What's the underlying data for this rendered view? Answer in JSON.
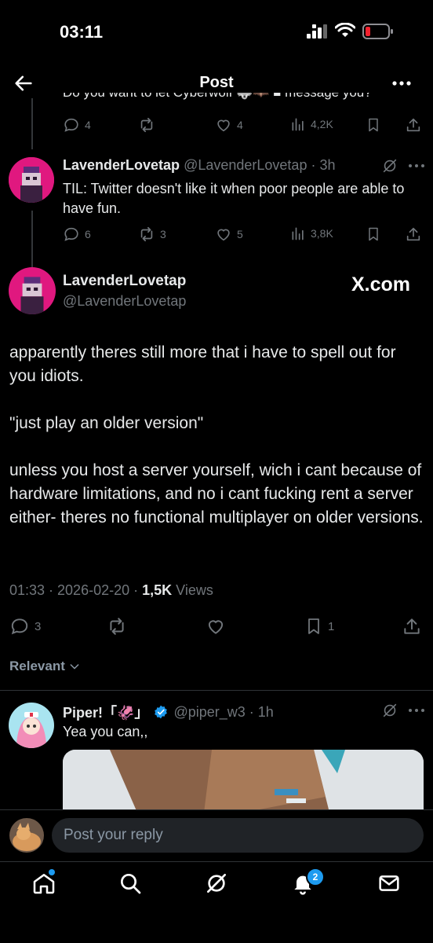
{
  "status_bar": {
    "time": "03:11"
  },
  "header": {
    "title": "Post"
  },
  "prev_tweet": {
    "clipped_text": "Do you want to let Cyberwolf 🐺🦇 ■ message you?",
    "replies": "4",
    "reposts": "",
    "likes": "4",
    "views": "4,2K"
  },
  "reply_tweet": {
    "display_name": "LavenderLovetap",
    "handle": "@LavenderLovetap",
    "time": "3h",
    "text": "TIL: Twitter doesn't like it when poor people are able to have fun.",
    "replies": "6",
    "reposts": "3",
    "likes": "5",
    "views": "3,8K"
  },
  "main_tweet": {
    "display_name": "LavenderLovetap",
    "handle": "@LavenderLovetap",
    "brand": "X.com",
    "paragraphs": [
      "apparently theres still more that i have to spell out for you idiots.",
      "\"just play an older version\"",
      "unless you host a server yourself, wich i cant because of hardware limitations, and no i cant fucking rent a server either- theres no functional multiplayer on older versions."
    ],
    "timestamp": "01:33 · 2026-02-20 · ",
    "views_count": "1,5K",
    "views_label": " Views",
    "replies": "3",
    "reposts": "",
    "likes": "",
    "bookmarks": "1"
  },
  "sort": {
    "label": "Relevant"
  },
  "reply2": {
    "display_name": "Piper!「🦑」",
    "handle": "@piper_w3",
    "time": "1h",
    "text": "Yea you can,,"
  },
  "composer": {
    "placeholder": "Post your reply"
  },
  "tabbar": {
    "notifications_badge": "2"
  },
  "colors": {
    "accent": "#1d9bf0",
    "background": "#000000",
    "muted": "#71767b",
    "battery_low": "#f4212e"
  }
}
